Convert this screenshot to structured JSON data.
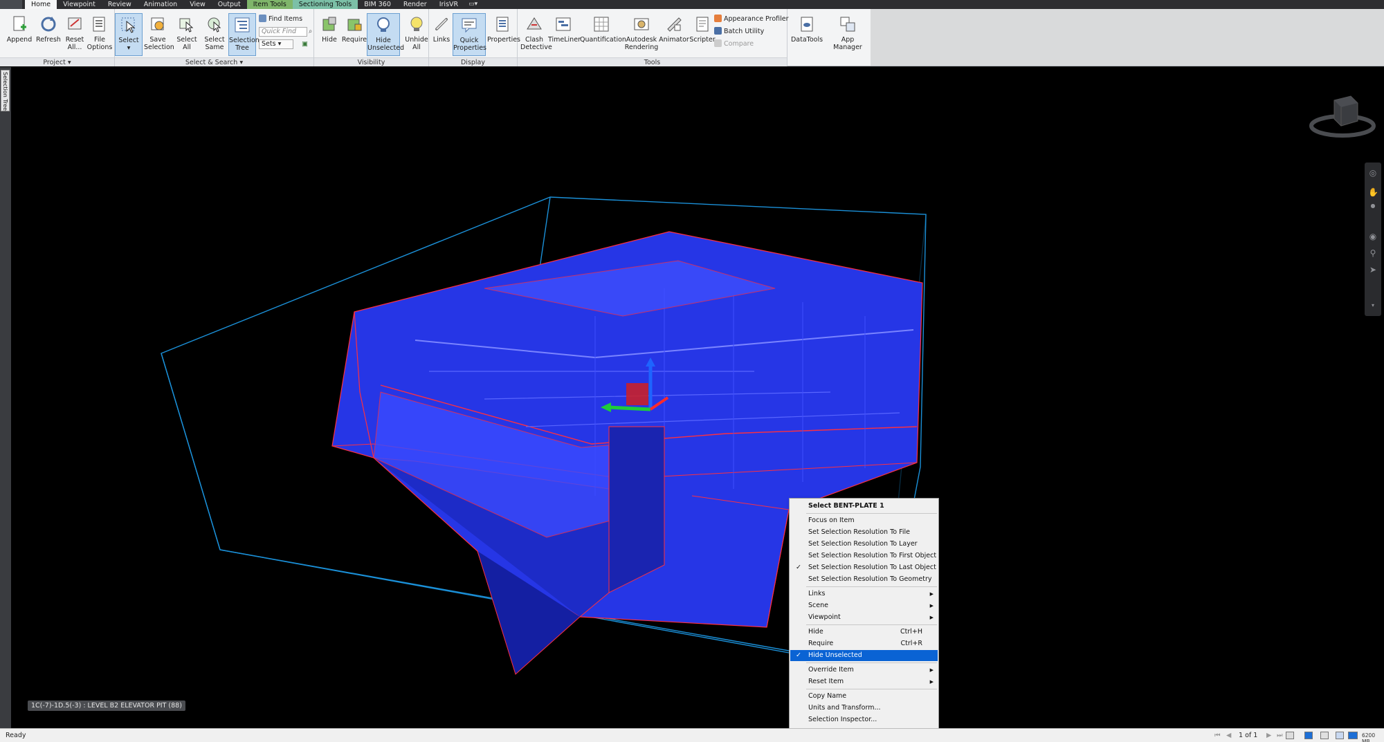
{
  "tabs": [
    {
      "label": "Home",
      "style": "active"
    },
    {
      "label": "Viewpoint",
      "style": ""
    },
    {
      "label": "Review",
      "style": ""
    },
    {
      "label": "Animation",
      "style": ""
    },
    {
      "label": "View",
      "style": ""
    },
    {
      "label": "Output",
      "style": ""
    },
    {
      "label": "Item Tools",
      "style": "ctx-green"
    },
    {
      "label": "Sectioning Tools",
      "style": "ctx-teal"
    },
    {
      "label": "BIM 360",
      "style": ""
    },
    {
      "label": "Render",
      "style": ""
    },
    {
      "label": "IrisVR",
      "style": ""
    }
  ],
  "ribbon": {
    "project": {
      "label": "Project ▾",
      "append": "Append",
      "refresh": "Refresh",
      "reset_all_1": "Reset",
      "reset_all_2": "All...",
      "file_options_1": "File",
      "file_options_2": "Options"
    },
    "select_search": {
      "label": "Select & Search ▾",
      "select": "Select",
      "save_selection_1": "Save",
      "save_selection_2": "Selection",
      "select_all_1": "Select",
      "select_all_2": "All",
      "select_same_1": "Select",
      "select_same_2": "Same",
      "selection_tree_1": "Selection",
      "selection_tree_2": "Tree",
      "find_items": "Find Items",
      "quick_find_placeholder": "Quick Find",
      "sets": "Sets"
    },
    "visibility": {
      "label": "Visibility",
      "hide": "Hide",
      "require": "Require",
      "hide_unselected_1": "Hide",
      "hide_unselected_2": "Unselected",
      "unhide_all_1": "Unhide",
      "unhide_all_2": "All"
    },
    "display": {
      "label": "Display",
      "links": "Links",
      "quick_properties_1": "Quick",
      "quick_properties_2": "Properties",
      "properties": "Properties"
    },
    "tools": {
      "label": "Tools",
      "clash_1": "Clash",
      "clash_2": "Detective",
      "timeliner": "TimeLiner",
      "quantification": "Quantification",
      "autodesk_rendering_1": "Autodesk",
      "autodesk_rendering_2": "Rendering",
      "animator": "Animator",
      "scripter": "Scripter",
      "appearance_profiler": "Appearance Profiler",
      "batch_utility": "Batch Utility",
      "compare": "Compare"
    },
    "datatools": "DataTools",
    "app_manager": "App Manager"
  },
  "side_tab": "Selection Tree",
  "model_label": "1C(-7)-1D.5(-3) : LEVEL B2 ELEVATOR PIT (88)",
  "context_menu": {
    "header": "Select BENT-PLATE 1",
    "focus": "Focus on Item",
    "res_file": "Set Selection Resolution To File",
    "res_layer": "Set Selection Resolution To Layer",
    "res_first": "Set Selection Resolution To First Object",
    "res_last": "Set Selection Resolution To Last Object",
    "res_geometry": "Set Selection Resolution To Geometry",
    "links": "Links",
    "scene": "Scene",
    "viewpoint": "Viewpoint",
    "hide": "Hide",
    "hide_shortcut": "Ctrl+H",
    "require": "Require",
    "require_shortcut": "Ctrl+R",
    "hide_unselected": "Hide Unselected",
    "override_item": "Override Item",
    "reset_item": "Reset Item",
    "copy_name": "Copy Name",
    "units_transform": "Units and Transform...",
    "selection_inspector": "Selection Inspector..."
  },
  "status": {
    "text": "Ready",
    "page": "1 of 1",
    "memory": "6200 MB"
  },
  "colors": {
    "model_fill": "#2a3cf0",
    "model_edge": "#e0323c",
    "section_box": "#1ea0f0",
    "menu_highlight": "#0a63d4"
  }
}
